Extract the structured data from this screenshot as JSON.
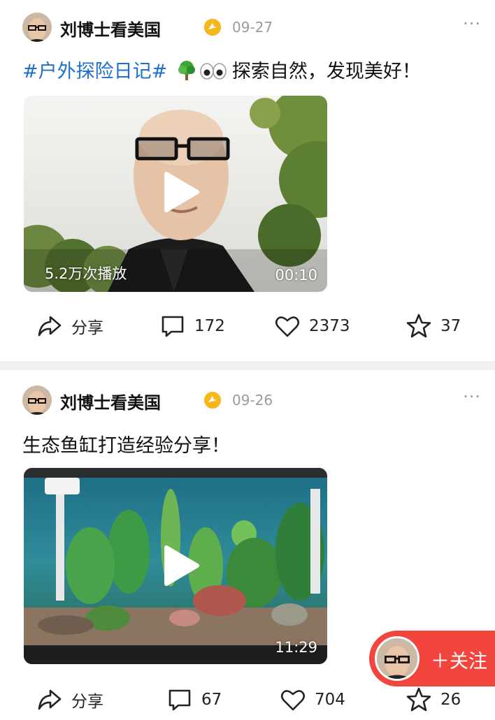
{
  "posts": [
    {
      "username": "刘博士看美国",
      "date": "09-27",
      "more": "···",
      "hashtag": "#户外探险日记#",
      "text": "探索自然，发现美好！",
      "video": {
        "views": "5.2万次播放",
        "duration": "00:10"
      },
      "actions": {
        "share": "分享",
        "comments": "172",
        "likes": "2373",
        "favorites": "37"
      }
    },
    {
      "username": "刘博士看美国",
      "date": "09-26",
      "more": "···",
      "text": "生态鱼缸打造经验分享！",
      "video": {
        "duration": "11:29"
      },
      "actions": {
        "share": "分享",
        "comments": "67",
        "likes": "704",
        "favorites": "26"
      }
    }
  ],
  "follow": {
    "label": "＋关注"
  },
  "colors": {
    "accent": "#f2453d",
    "hashtag": "#1f6fd1",
    "verified": "#f6b71c"
  }
}
